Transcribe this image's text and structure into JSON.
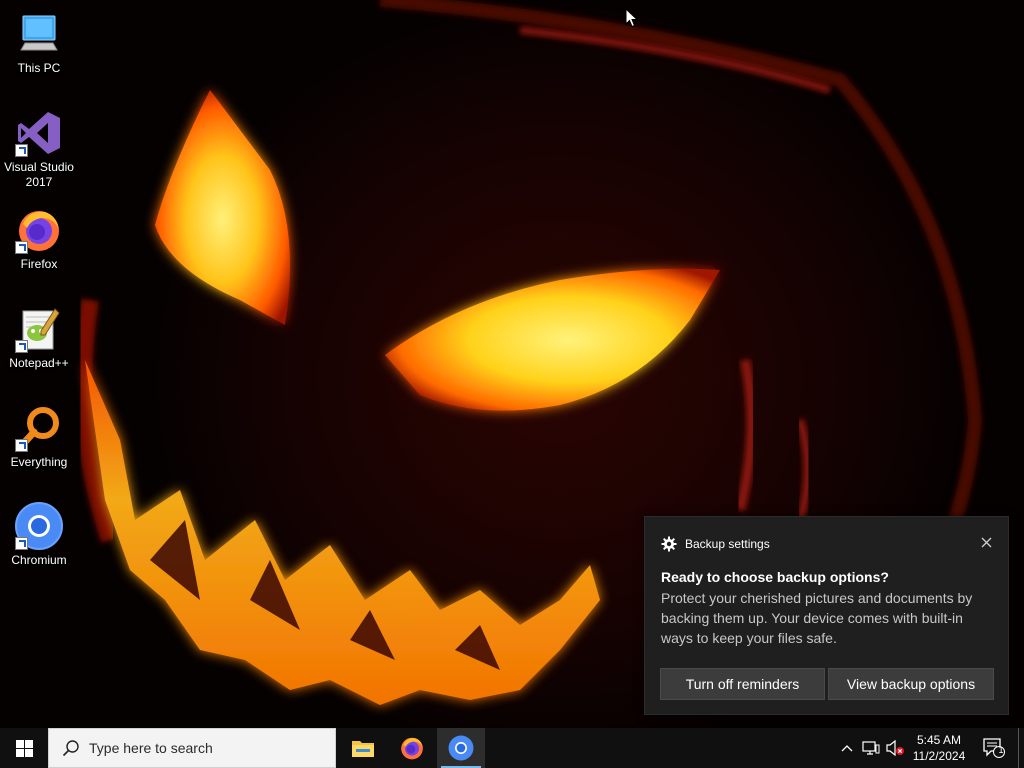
{
  "desktop": {
    "icons": [
      {
        "label": "This PC",
        "icon": "this-pc-icon"
      },
      {
        "label": "Visual Studio 2017",
        "icon": "visual-studio-icon"
      },
      {
        "label": "Firefox",
        "icon": "firefox-icon"
      },
      {
        "label": "Notepad++",
        "icon": "notepadpp-icon"
      },
      {
        "label": "Everything",
        "icon": "everything-icon"
      },
      {
        "label": "Chromium",
        "icon": "chromium-icon"
      }
    ]
  },
  "toast": {
    "app_name": "Backup settings",
    "title": "Ready to choose backup options?",
    "body": "Protect your cherished pictures and documents by backing them up. Your device comes with built-in ways to keep your files safe.",
    "button_primary": "Turn off reminders",
    "button_secondary": "View backup options"
  },
  "taskbar": {
    "search_placeholder": "Type here to search",
    "pinned_apps": [
      "file-explorer-icon",
      "firefox-icon",
      "chromium-icon"
    ],
    "active_app": "Chromium",
    "clock_time": "5:45 AM",
    "clock_date": "11/2/2024",
    "notification_count": "1"
  },
  "colors": {
    "taskbar_bg": "#101010",
    "toast_bg": "#1f1f1f",
    "accent": "#76b9ed",
    "flame_yellow": "#ffd21a",
    "flame_orange": "#ff6a00"
  }
}
